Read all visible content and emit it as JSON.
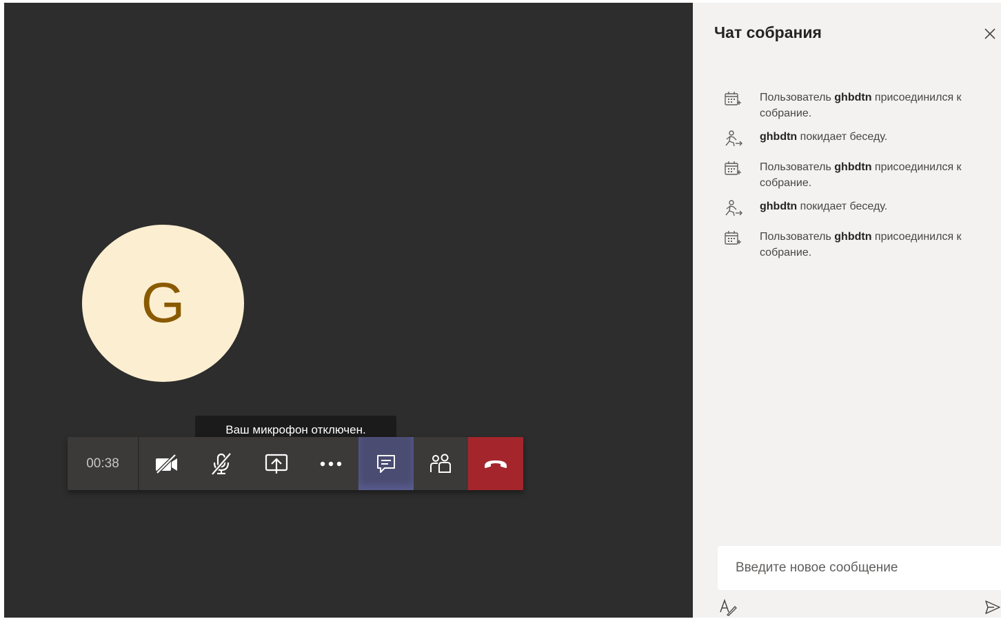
{
  "meeting": {
    "avatar_initial": "G",
    "tooltip": "Ваш микрофон отключен.",
    "timer": "00:38",
    "toolbar": [
      {
        "name": "camera-off-button",
        "icon": "camera-off-icon"
      },
      {
        "name": "mic-off-button",
        "icon": "mic-off-icon"
      },
      {
        "name": "share-screen-button",
        "icon": "share-screen-icon"
      },
      {
        "name": "more-actions-button",
        "icon": "more-icon"
      },
      {
        "name": "chat-button",
        "icon": "chat-icon",
        "active": true
      },
      {
        "name": "participants-button",
        "icon": "participants-icon"
      },
      {
        "name": "hang-up-button",
        "icon": "hang-up-icon",
        "color": "#a4262c"
      }
    ]
  },
  "chat": {
    "title": "Чат собрания",
    "messages": [
      {
        "icon": "calendar-join-icon",
        "prefix": "Пользователь ",
        "user": "ghbdtn",
        "suffix": " присоединился к собрание."
      },
      {
        "icon": "person-leave-icon",
        "prefix": "",
        "user": "ghbdtn",
        "suffix": " покидает беседу."
      },
      {
        "icon": "calendar-join-icon",
        "prefix": "Пользователь ",
        "user": "ghbdtn",
        "suffix": " присоединился к собрание."
      },
      {
        "icon": "person-leave-icon",
        "prefix": "",
        "user": "ghbdtn",
        "suffix": " покидает беседу."
      },
      {
        "icon": "calendar-join-icon",
        "prefix": "Пользователь ",
        "user": "ghbdtn",
        "suffix": " присоединился к собрание."
      }
    ],
    "compose_placeholder": "Введите новое сообщение"
  },
  "colors": {
    "stage_bg": "#2d2d2d",
    "panel_bg": "#f3f2f1",
    "avatar_bg": "#fcefd1",
    "avatar_text": "#8a5a00",
    "active_button": "#4a4c71",
    "hang_up": "#a4262c"
  }
}
